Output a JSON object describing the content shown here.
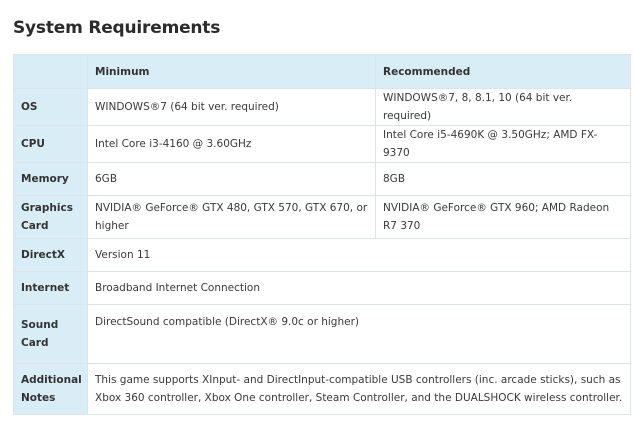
{
  "title": "System Requirements",
  "table": {
    "headers": [
      "",
      "Minimum",
      "Recommended"
    ],
    "rows": [
      {
        "label": "OS",
        "minimum": "WINDOWS®7 (64 bit ver. required)",
        "recommended": "WINDOWS®7, 8, 8.1, 10 (64 bit ver. required)"
      },
      {
        "label": "CPU",
        "minimum": "Intel Core i3-4160 @ 3.60GHz",
        "recommended": "Intel Core i5-4690K @ 3.50GHz; AMD FX-9370"
      },
      {
        "label": "Memory",
        "minimum": "6GB",
        "recommended": "8GB"
      },
      {
        "label": "Graphics Card",
        "minimum": "NVIDIA® GeForce® GTX 480, GTX 570, GTX 670, or higher",
        "recommended": "NVIDIA® GeForce® GTX 960; AMD Radeon R7 370"
      },
      {
        "label": "DirectX",
        "value": "Version 11"
      },
      {
        "label": "Internet",
        "value": "Broadband Internet Connection"
      },
      {
        "label": "Sound Card",
        "value": "DirectSound compatible (DirectX® 9.0c or higher)"
      },
      {
        "label": "Additional Notes",
        "value": "This game supports XInput- and DirectInput-compatible USB controllers (inc. arcade sticks), such as Xbox 360 controller, Xbox One controller, Steam Controller, and the DUALSHOCK wireless controller."
      }
    ]
  }
}
